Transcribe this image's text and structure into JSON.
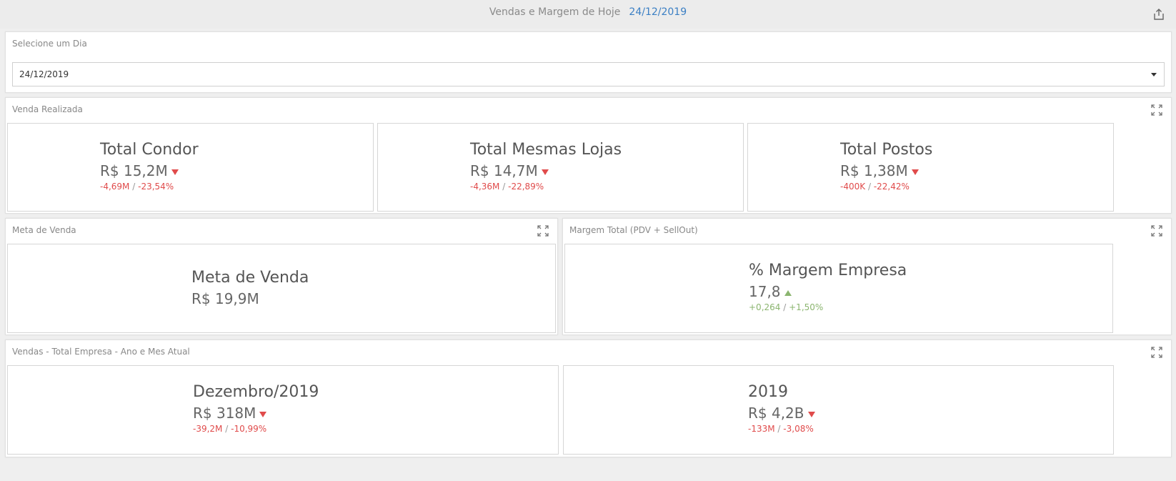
{
  "header": {
    "title": "Vendas e Margem de Hoje",
    "date": "24/12/2019",
    "export_icon": "export-icon"
  },
  "colors": {
    "negative": "#e04b4b",
    "positive": "#8bb56f",
    "accent": "#3b7fc4"
  },
  "day_selector": {
    "title": "Selecione um Dia",
    "value": "24/12/2019"
  },
  "venda_realizada": {
    "title": "Venda Realizada",
    "cards": [
      {
        "name": "Total Condor",
        "value": "R$ 15,2M",
        "delta_abs": "-4,69M",
        "sep": "/",
        "delta_pct": "-23,54%",
        "trend": "down"
      },
      {
        "name": "Total Mesmas Lojas",
        "value": "R$ 14,7M",
        "delta_abs": "-4,36M",
        "sep": "/",
        "delta_pct": "-22,89%",
        "trend": "down"
      },
      {
        "name": "Total Postos",
        "value": "R$ 1,38M",
        "delta_abs": "-400K",
        "sep": "/",
        "delta_pct": "-22,42%",
        "trend": "down"
      }
    ]
  },
  "meta_venda": {
    "title": "Meta de Venda",
    "card": {
      "name": "Meta de Venda",
      "value": "R$ 19,9M"
    }
  },
  "margem_total": {
    "title": "Margem Total (PDV + SellOut)",
    "card": {
      "name": "% Margem Empresa",
      "value": "17,8",
      "delta_abs": "+0,264",
      "sep": "/",
      "delta_pct": "+1,50%",
      "trend": "up"
    }
  },
  "vendas_empresa": {
    "title": "Vendas - Total Empresa - Ano e Mes Atual",
    "cards": [
      {
        "name": "Dezembro/2019",
        "value": "R$ 318M",
        "delta_abs": "-39,2M",
        "sep": "/",
        "delta_pct": "-10,99%",
        "trend": "down"
      },
      {
        "name": "2019",
        "value": "R$ 4,2B",
        "delta_abs": "-133M",
        "sep": "/",
        "delta_pct": "-3,08%",
        "trend": "down"
      }
    ]
  }
}
